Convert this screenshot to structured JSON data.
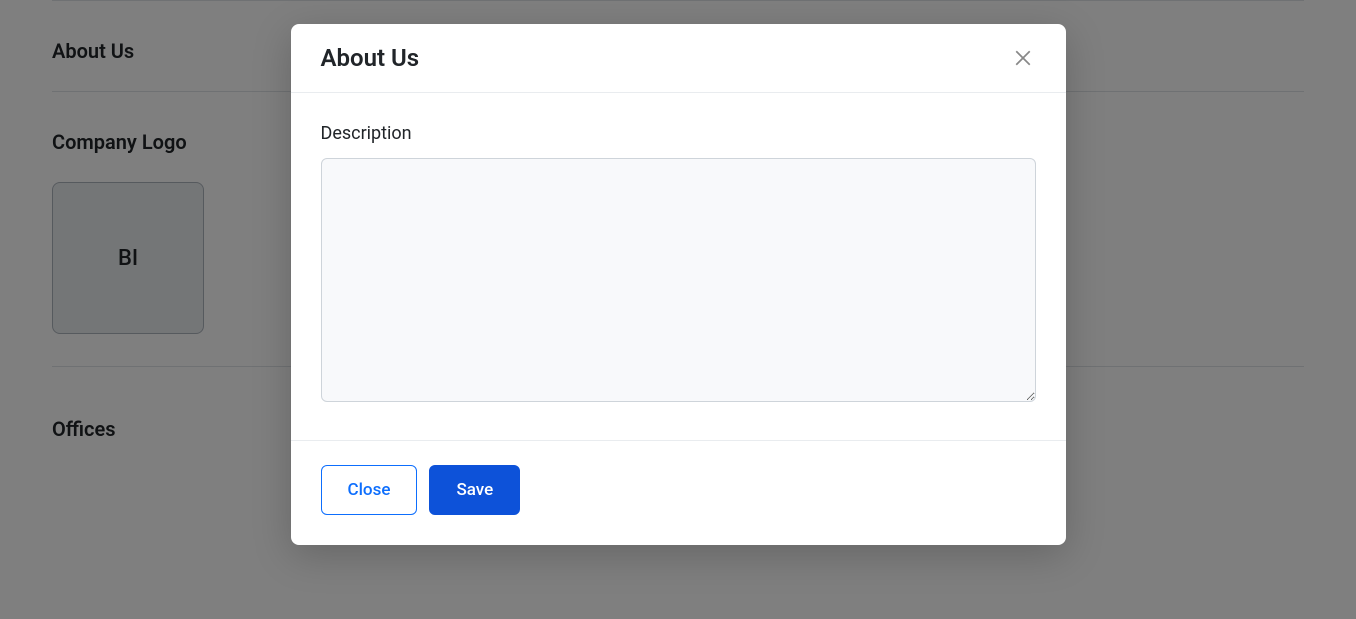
{
  "page": {
    "sections": {
      "about_us": {
        "heading": "About Us"
      },
      "company_logo": {
        "heading": "Company Logo",
        "logo_text": "BI"
      },
      "offices": {
        "heading": "Offices"
      }
    }
  },
  "modal": {
    "title": "About Us",
    "description_label": "Description",
    "description_value": "",
    "buttons": {
      "close": "Close",
      "save": "Save"
    }
  }
}
